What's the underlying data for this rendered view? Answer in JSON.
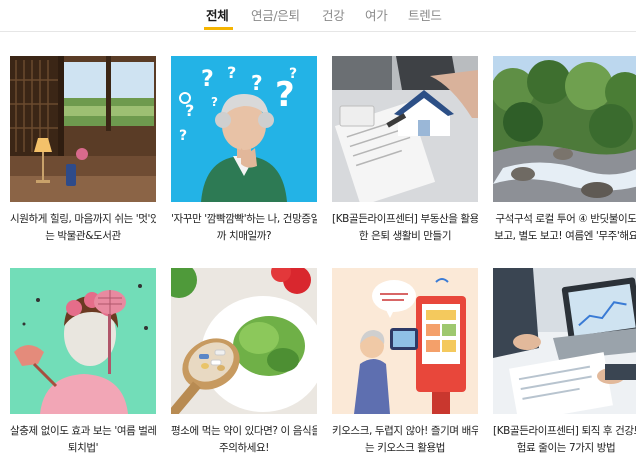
{
  "tabs": [
    {
      "label": "전체",
      "active": true
    },
    {
      "label": "연금/은퇴",
      "active": false
    },
    {
      "label": "건강",
      "active": false
    },
    {
      "label": "여가",
      "active": false
    },
    {
      "label": "트렌드",
      "active": false
    }
  ],
  "accent_color": "#f5b400",
  "articles": [
    {
      "lines": [
        "시원하게 힐링, 마음까지 쉬는 '멋'있",
        "는 박물관&도서관"
      ],
      "image": "window-room"
    },
    {
      "lines": [
        "'자꾸만 '깜빡깜빡'하는 나, 건망증일",
        "까 치매일까?"
      ],
      "image": "woman-question-marks"
    },
    {
      "lines": [
        "[KB골든라이프센터] 부동산을 활용",
        "한 은퇴 생활비 만들기"
      ],
      "image": "house-model-contract"
    },
    {
      "lines": [
        "구석구석 로컬 투어 ④ 반딧불이도",
        "보고, 별도 보고! 여름엔 '무주'해요"
      ],
      "image": "forest-stream"
    },
    {
      "lines": [
        "살충제 없이도 효과 보는 '여름 벌레",
        "퇴치법'"
      ],
      "image": "woman-flyswatter"
    },
    {
      "lines": [
        "평소에 먹는 약이 있다면? 이 음식을",
        "주의하세요!"
      ],
      "image": "pills-salad"
    },
    {
      "lines": [
        "키오스크, 두렵지 않아! 즐기며 배우",
        "는 키오스크 활용법"
      ],
      "image": "kiosk-illustration"
    },
    {
      "lines": [
        "[KB골든라이프센터] 퇴직 후 건강보",
        "험료 줄이는 7가지 방법"
      ],
      "image": "laptop-documents"
    }
  ]
}
